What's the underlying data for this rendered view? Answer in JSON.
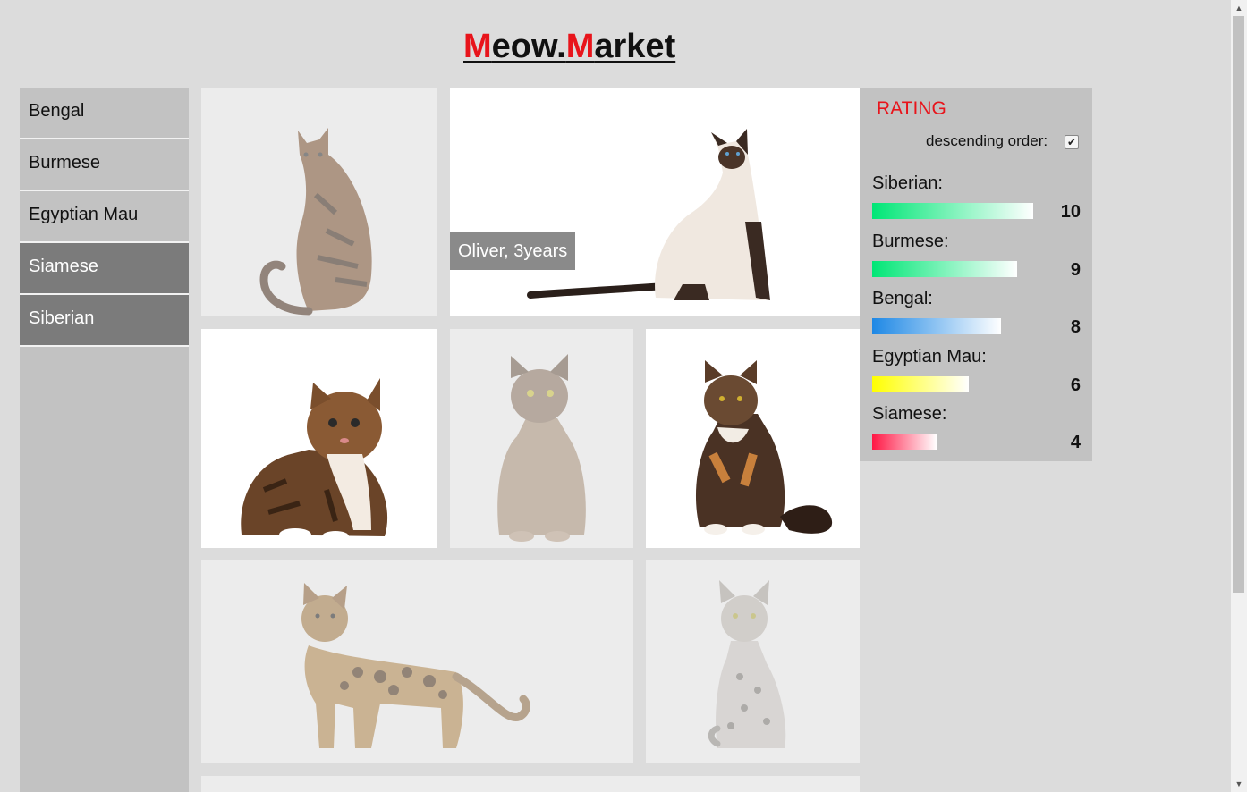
{
  "header": {
    "title_m1": "M",
    "title_p1": "eow.",
    "title_m2": "M",
    "title_p2": "arket"
  },
  "sidebar": {
    "items": [
      {
        "label": "Bengal",
        "active": false
      },
      {
        "label": "Burmese",
        "active": false
      },
      {
        "label": "Egyptian Mau",
        "active": false
      },
      {
        "label": "Siamese",
        "active": true
      },
      {
        "label": "Siberian",
        "active": true
      }
    ]
  },
  "gallery": {
    "featured_caption": "Oliver, 3years"
  },
  "rating": {
    "title": "RATING",
    "order_label": "descending order:",
    "descending": true,
    "checkbox_mark": "✔",
    "items": [
      {
        "name": "Siberian:",
        "value": 10,
        "color": "#00e676"
      },
      {
        "name": "Burmese:",
        "value": 9,
        "color": "#00e676"
      },
      {
        "name": "Bengal:",
        "value": 8,
        "color": "#1e88e5"
      },
      {
        "name": "Egyptian Mau:",
        "value": 6,
        "color": "#ffff00"
      },
      {
        "name": "Siamese:",
        "value": 4,
        "color": "#ff1744"
      }
    ]
  },
  "colors": {
    "accent": "#e8141b",
    "active_nav": "#7b7b7b",
    "panel": "#c2c2c2",
    "page": "#dcdcdc"
  }
}
